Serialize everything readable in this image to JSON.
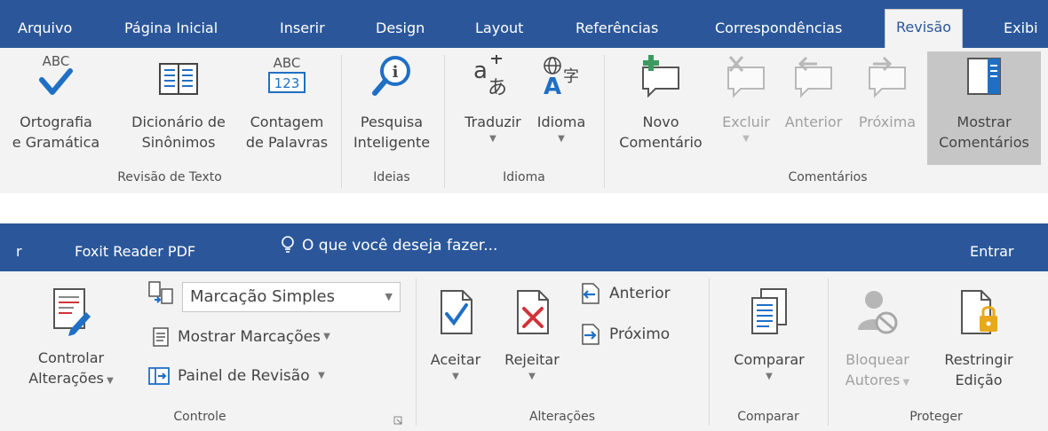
{
  "ribbon1": {
    "tabs": [
      "Arquivo",
      "Página Inicial",
      "Inserir",
      "Design",
      "Layout",
      "Referências",
      "Correspondências",
      "Revisão",
      "Exibi"
    ],
    "groups": {
      "revisao_texto": {
        "label": "Revisão de Texto",
        "ortografia": {
          "line1": "Ortografia",
          "line2": "e Gramática",
          "icon_text": "ABC"
        },
        "dicionario": {
          "line1": "Dicionário de",
          "line2": "Sinônimos"
        },
        "contagem": {
          "line1": "Contagem",
          "line2": "de Palavras",
          "icon_text_top": "ABC",
          "icon_text_bottom": "123"
        }
      },
      "ideias": {
        "label": "Ideias",
        "pesquisa": {
          "line1": "Pesquisa",
          "line2": "Inteligente"
        }
      },
      "idioma": {
        "label": "Idioma",
        "traduzir": {
          "label": "Traduzir"
        },
        "idioma": {
          "label": "Idioma"
        }
      },
      "comentarios": {
        "label": "Comentários",
        "novo": {
          "line1": "Novo",
          "line2": "Comentário"
        },
        "excluir": {
          "label": "Excluir"
        },
        "anterior": {
          "label": "Anterior"
        },
        "proxima": {
          "label": "Próxima"
        },
        "mostrar": {
          "line1": "Mostrar",
          "line2": "Comentários"
        }
      }
    }
  },
  "ribbon2": {
    "tab_partial": "r",
    "tab_foxit": "Foxit Reader PDF",
    "search_text": "O que você deseja fazer...",
    "signin": "Entrar",
    "groups": {
      "controle": {
        "label": "Controle",
        "controlar": {
          "line1": "Controlar",
          "line2": "Alterações"
        },
        "markup_dropdown": "Marcação Simples",
        "mostrar_marcacoes": "Mostrar Marcações",
        "painel_revisao": "Painel de Revisão"
      },
      "alteracoes": {
        "label": "Alterações",
        "aceitar": "Aceitar",
        "rejeitar": "Rejeitar",
        "anterior": "Anterior",
        "proximo": "Próximo"
      },
      "comparar": {
        "label": "Comparar",
        "comparar": "Comparar"
      },
      "proteger": {
        "label": "Proteger",
        "bloquear": {
          "line1": "Bloquear",
          "line2": "Autores"
        },
        "restringir": {
          "line1": "Restringir",
          "line2": "Edição"
        }
      }
    }
  },
  "colors": {
    "tab_bar": "#2b579a",
    "ribbon_bg": "#f3f3f3",
    "accent_blue": "#1f6fc5",
    "reject_red": "#d13438",
    "comment_green": "#3c9a5f",
    "lock_gold": "#e8a81c",
    "selected_bg": "#c6c6c6"
  },
  "icons": [
    "spellcheck-icon",
    "thesaurus-icon",
    "word-count-icon",
    "smart-lookup-icon",
    "translate-icon",
    "language-icon",
    "new-comment-icon",
    "delete-comment-icon",
    "previous-comment-icon",
    "next-comment-icon",
    "show-comments-icon",
    "track-changes-icon",
    "markup-icon",
    "show-markup-icon",
    "review-pane-icon",
    "accept-icon",
    "reject-icon",
    "previous-change-icon",
    "next-change-icon",
    "compare-icon",
    "block-authors-icon",
    "restrict-editing-icon",
    "lightbulb-icon",
    "dialog-launcher-icon"
  ]
}
